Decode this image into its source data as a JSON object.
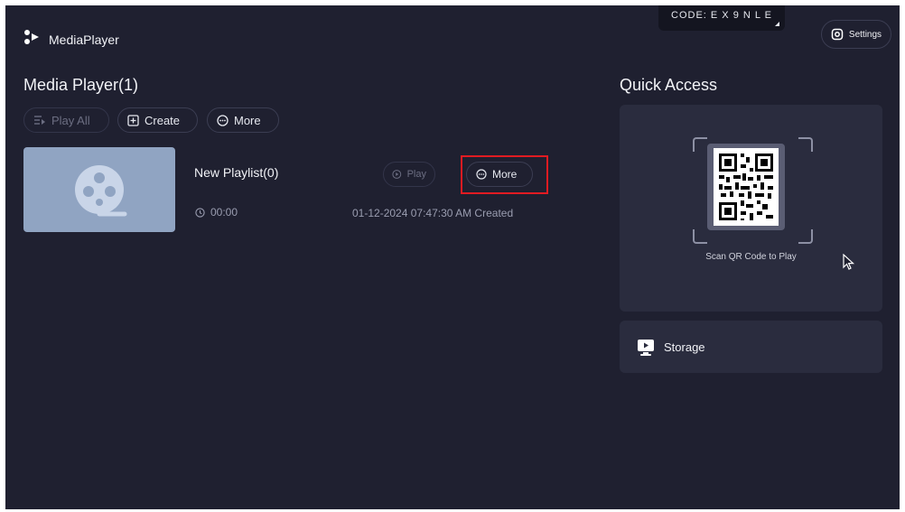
{
  "header": {
    "app_name": "MediaPlayer",
    "code_label": "CODE: E X 9 N L E",
    "settings_label": "Settings"
  },
  "left": {
    "title": "Media Player(1)",
    "toolbar": {
      "play_all": "Play All",
      "create": "Create",
      "more": "More"
    },
    "playlist": {
      "name": "New Playlist(0)",
      "duration": "00:00",
      "play_label": "Play",
      "more_label": "More",
      "created": "01-12-2024 07:47:30 AM Created"
    }
  },
  "quick_access": {
    "title": "Quick Access",
    "qr_caption": "Scan QR Code to Play",
    "storage_label": "Storage"
  },
  "colors": {
    "background": "#1f2030",
    "card": "#2a2c3e",
    "thumbnail": "#90a4c2",
    "highlight": "#e11b22"
  }
}
